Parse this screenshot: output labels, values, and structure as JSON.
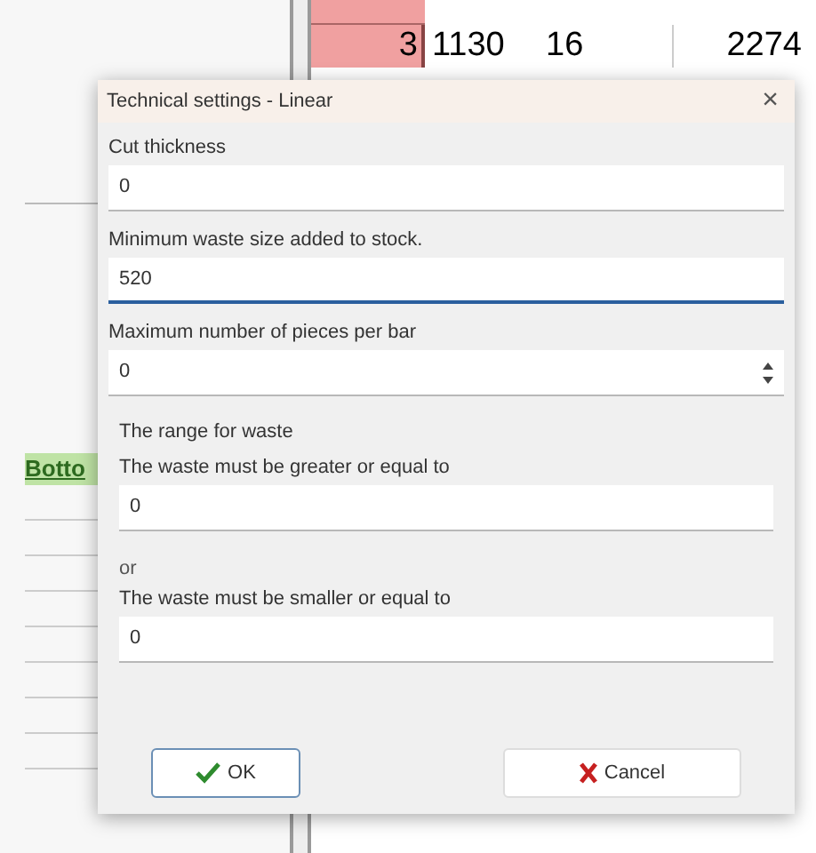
{
  "background": {
    "left_cell": "Botto",
    "table_rows": [
      {
        "cells": [
          "3",
          "1130",
          "16",
          "2274"
        ]
      }
    ]
  },
  "dialog": {
    "title": "Technical settings - Linear",
    "close": "×",
    "fields": [
      {
        "label": "Cut thickness",
        "value": "0",
        "kind": "text",
        "focused": false
      },
      {
        "label": "Minimum waste size added to stock.",
        "value": "520",
        "kind": "text",
        "focused": true
      },
      {
        "label": "Maximum number of pieces per bar",
        "value": "0",
        "kind": "spin",
        "focused": false
      }
    ],
    "group": {
      "title": "The range for waste",
      "items": [
        {
          "kind": "field",
          "label": "The waste must be greater or equal to",
          "value": "0"
        },
        {
          "kind": "text",
          "label": "or"
        },
        {
          "kind": "field",
          "label": "The waste must be smaller or equal to",
          "value": "0"
        }
      ]
    },
    "buttons": [
      {
        "label": "OK",
        "kind": "ok",
        "default": true
      },
      {
        "label": "Cancel",
        "kind": "cancel",
        "default": false
      }
    ]
  }
}
